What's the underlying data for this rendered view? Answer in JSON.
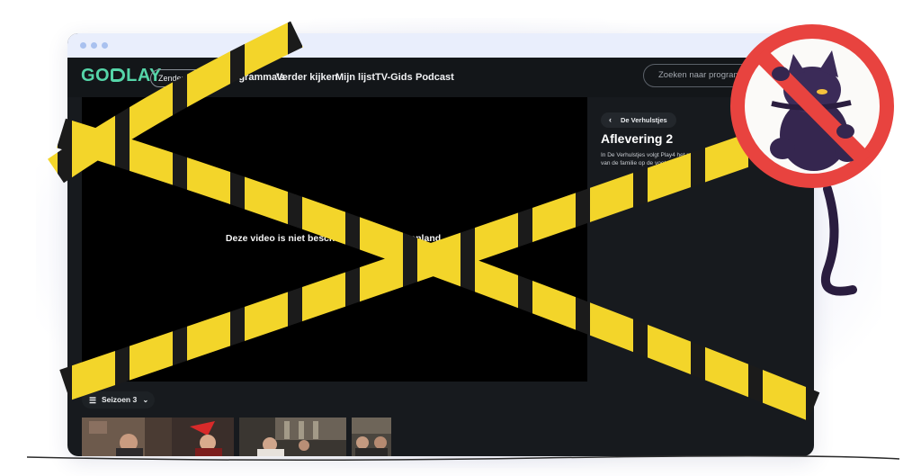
{
  "browser": {
    "dot_color": "#a9c1ef"
  },
  "header": {
    "logo_left": "GO",
    "logo_right": "LAY",
    "zender_label": "Zender",
    "nav_items": [
      {
        "label": "Programma's"
      },
      {
        "label": "Verder kijken"
      },
      {
        "label": "Mijn lijst"
      },
      {
        "label": "TV-Gids"
      },
      {
        "label": "Podcast"
      }
    ],
    "search_placeholder": "Zoeken naar programma"
  },
  "player": {
    "message": "Deze video is niet beschikbaar in het buitenland."
  },
  "episode": {
    "back_label": "De Verhulstjes",
    "title": "Aflevering 2",
    "description": "In De Verhulstjes volgt Play4 het reilen en zeilen van de familie op de voet"
  },
  "season": {
    "label": "Seizoen 3"
  },
  "colors": {
    "brand": "#55d5a8",
    "tape_yellow": "#f3d52a",
    "tape_stripe": "#1b1b1b",
    "prohibited_red": "#e8433f"
  },
  "icons": {
    "back": "chevron-left-icon",
    "season_list": "list-icon",
    "season_dropdown": "chevron-down-icon",
    "zender_dropdown": "chevron-down-icon",
    "overlay": "prohibited-sign-icon"
  }
}
